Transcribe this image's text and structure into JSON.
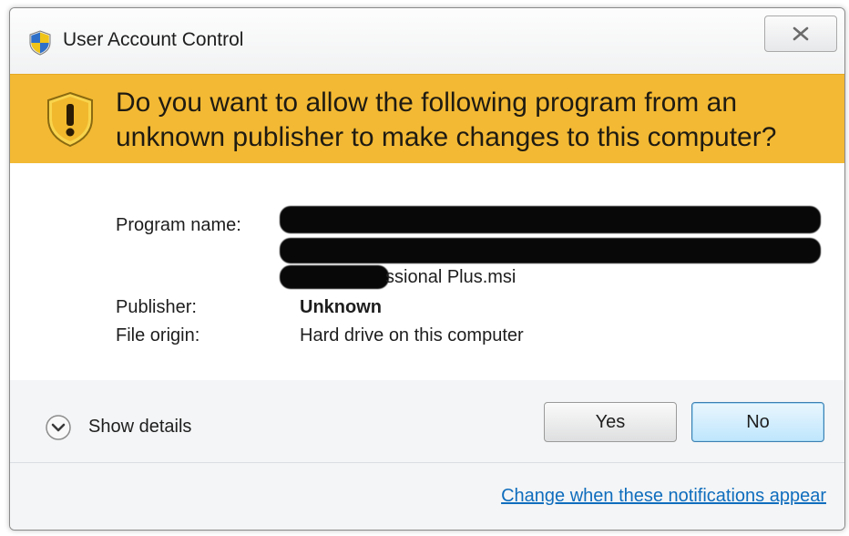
{
  "window": {
    "title": "User Account Control",
    "close_glyph": "✕"
  },
  "banner": {
    "question": "Do you want to allow the following program from an unknown publisher to make changes to this computer?"
  },
  "details": {
    "program_name_label": "Program name:",
    "program_name_visible_tail": "ssional Plus.msi",
    "publisher_label": "Publisher:",
    "publisher_value": "Unknown",
    "file_origin_label": "File origin:",
    "file_origin_value": "Hard drive on this computer"
  },
  "footer": {
    "show_details_label": "Show details",
    "yes_label": "Yes",
    "no_label": "No",
    "notifications_link": "Change when these notifications appear"
  },
  "icons": {
    "title": "uac-shield-icon",
    "banner": "warning-shield-icon",
    "details": "chevron-down-icon",
    "close": "close-icon"
  },
  "colors": {
    "banner": "#f3b934",
    "link": "#0f6dbd",
    "default_button": "#bee6fd"
  }
}
